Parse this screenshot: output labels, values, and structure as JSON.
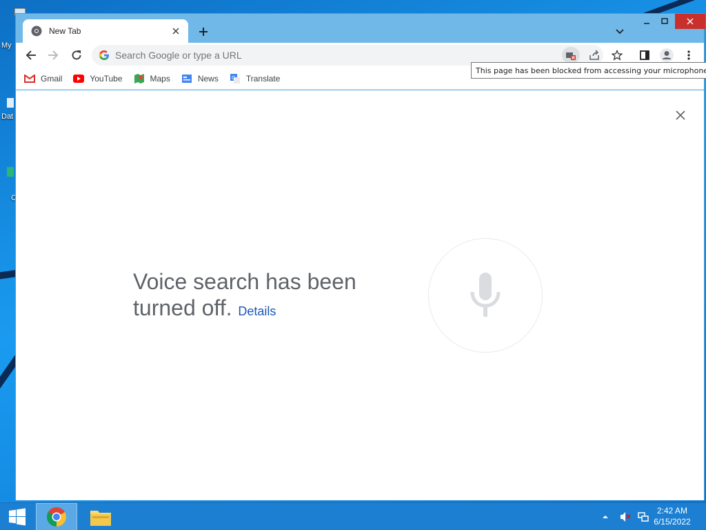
{
  "desktop": {
    "icon_labels": [
      "My",
      "Dat",
      "C"
    ]
  },
  "browser": {
    "tab": {
      "title": "New Tab"
    },
    "omnibox": {
      "placeholder": "Search Google or type a URL"
    },
    "tooltip": "This page has been blocked from accessing your microphone.",
    "bookmarks": [
      {
        "label": "Gmail",
        "icon": "gmail-icon"
      },
      {
        "label": "YouTube",
        "icon": "youtube-icon"
      },
      {
        "label": "Maps",
        "icon": "maps-icon"
      },
      {
        "label": "News",
        "icon": "news-icon"
      },
      {
        "label": "Translate",
        "icon": "translate-icon"
      }
    ],
    "voice": {
      "message": "Voice search has been turned off.",
      "details_link": "Details"
    },
    "colors": {
      "accent": "#1a73e8",
      "link": "#1a56b8",
      "close_red": "#c9302c"
    }
  },
  "taskbar": {
    "clock_time": "2:42 AM",
    "clock_date": "6/15/2022"
  }
}
